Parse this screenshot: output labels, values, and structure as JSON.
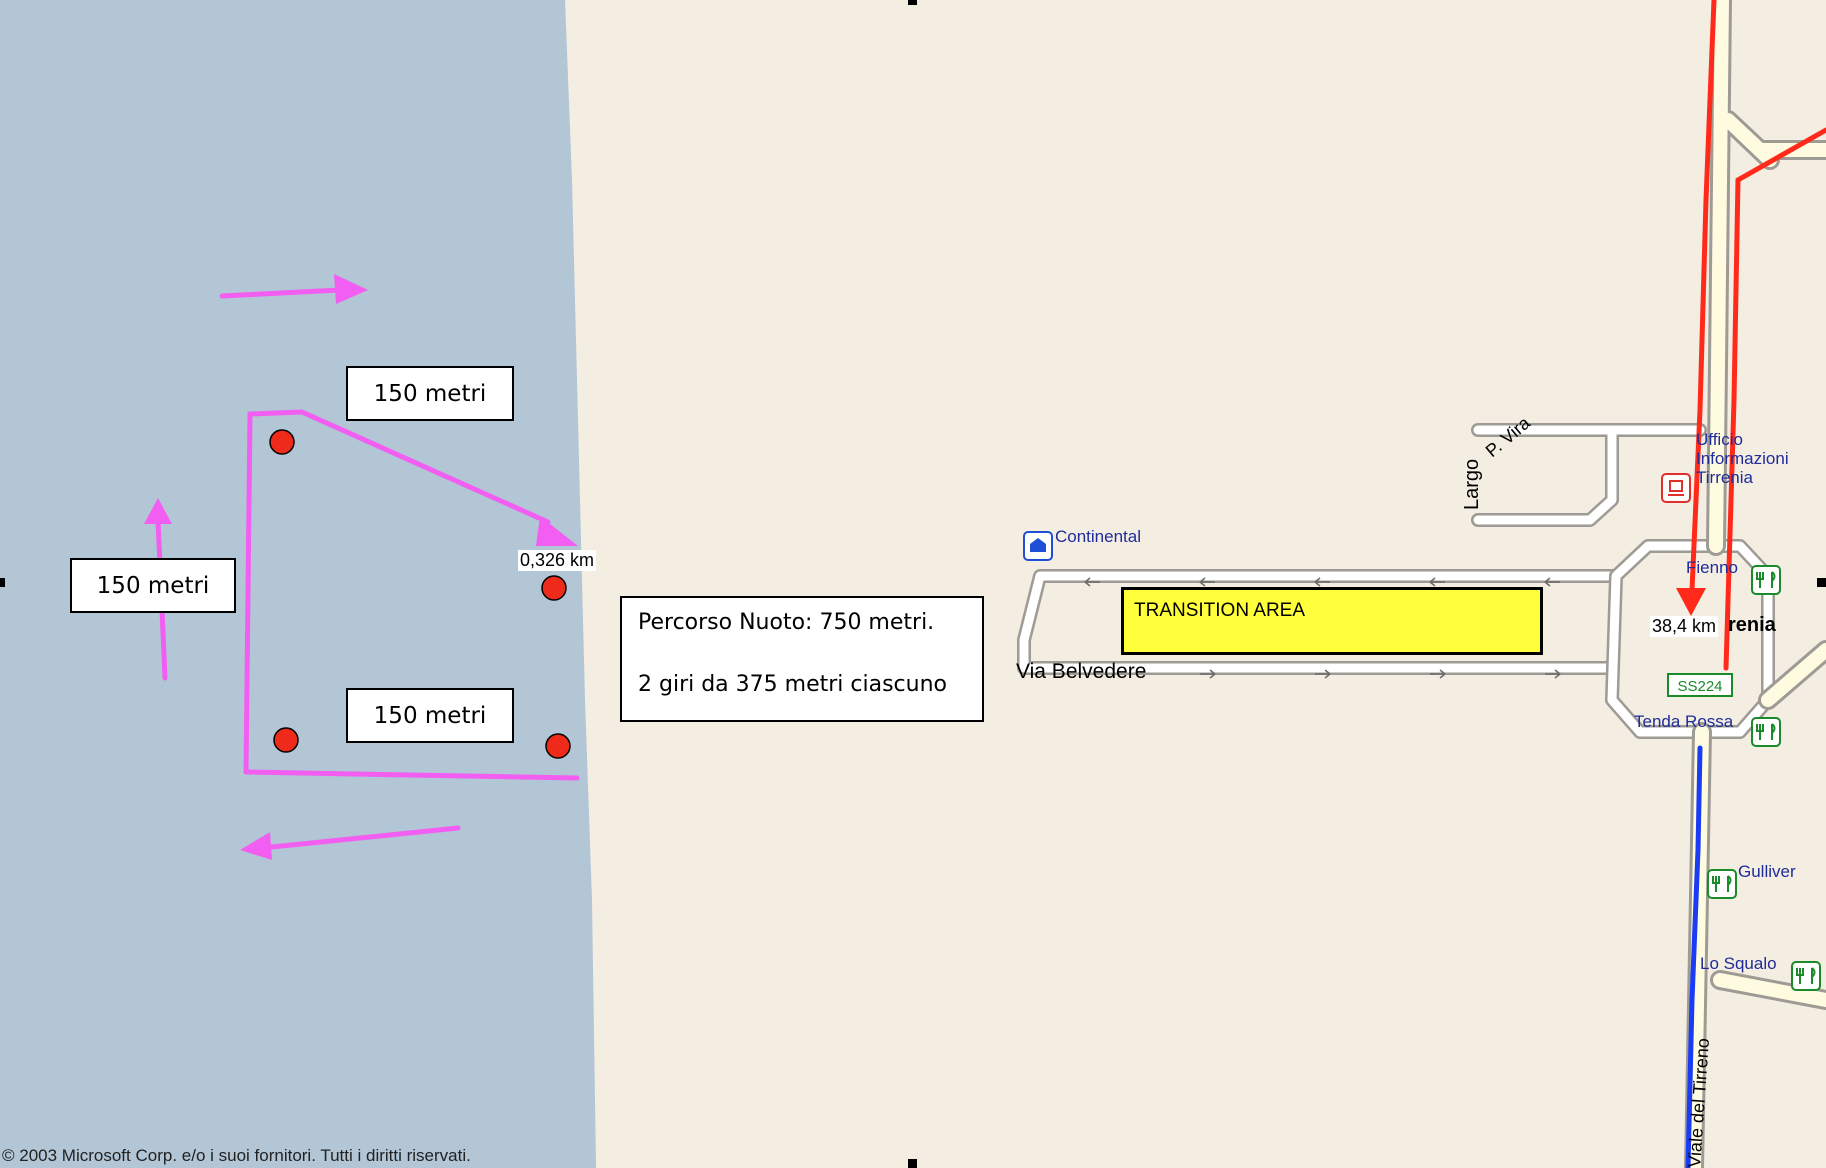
{
  "colors": {
    "sea": "#b3c6d5",
    "land": "#f3ede2",
    "course": "#f25ef2",
    "buoy": "#ee2a1a",
    "road_casing": "#9e9a94",
    "road_fill": "#ffffff",
    "main_road_fill": "#fffbe0",
    "route_red": "#ff2a1a",
    "route_blue": "#1a3cf5",
    "transition": "#ffff3c"
  },
  "labels": {
    "distance_top": "150 metri",
    "distance_left": "150 metri",
    "distance_bottom": "150 metri",
    "swim_info_line1": "Percorso Nuoto: 750 metri.",
    "swim_info_line2": "2 giri da 375 metri ciascuno",
    "km_swim": "0,326 km",
    "km_route": "38,4 km",
    "transition_area": "TRANSITION AREA"
  },
  "map": {
    "road_via_belvedere": "Via Belvedere",
    "road_largo": "Largo",
    "road_largo_fragment": "P. Vira",
    "road_viale_del_tirreno": "Viale del Tirreno",
    "town_fragment": "renia",
    "route_shield": "SS224",
    "pois": {
      "continental": "Continental",
      "ufficio": "Ufficio Informazioni Tirrenia",
      "fienno": "Fienno",
      "tenda_rossa": "Tenda Rossa",
      "gulliver": "Gulliver",
      "lo_squalo": "Lo Squalo"
    },
    "poi_icons": [
      "hotel-icon",
      "info-office-icon",
      "restaurant-icon"
    ]
  },
  "copyright": "© 2003 Microsoft Corp. e/o i suoi fornitori. Tutti i diritti riservati."
}
